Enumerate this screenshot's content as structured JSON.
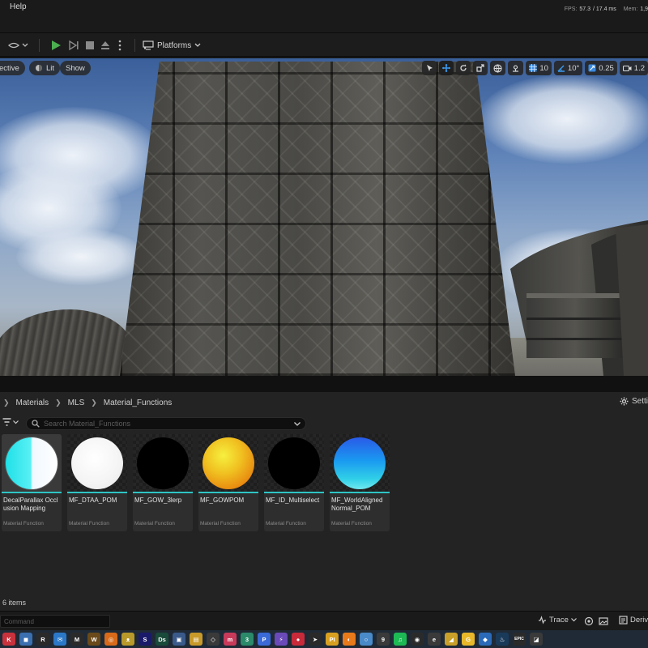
{
  "menu": {
    "help_label": "Help"
  },
  "stats": {
    "fps_label": "FPS:",
    "fps_value": "57.3",
    "ms_value": "/ 17.4 ms",
    "mem_label": "Mem:",
    "mem_value": "1,9"
  },
  "toolbar": {
    "platforms_label": "Platforms"
  },
  "viewport": {
    "perspective_label": "ective",
    "lit_label": "Lit",
    "show_label": "Show",
    "grid_snap": "10",
    "rotation_snap": "10°",
    "scale_snap": "0.25",
    "camera_speed": "1.2"
  },
  "content_browser": {
    "breadcrumb": [
      "Materials",
      "MLS",
      "Material_Functions"
    ],
    "settings_label": "Setti",
    "search_placeholder": "Search Material_Functions",
    "assets": [
      {
        "name": "DecalParallax Occlusion Mapping",
        "type": "Material Function",
        "color": "#28d8e0"
      },
      {
        "name": "MF_DTAA_POM",
        "type": "Material Function",
        "color": "#ffffff"
      },
      {
        "name": "MF_GOW_3lerp",
        "type": "Material Function",
        "color": "#000000"
      },
      {
        "name": "MF_GOWPOM",
        "type": "Material Function",
        "color": "#f0b020"
      },
      {
        "name": "MF_ID_Multiselect",
        "type": "Material Function",
        "color": "#000000"
      },
      {
        "name": "MF_WorldAligned Normal_POM",
        "type": "Material Function",
        "color": "#2a9af0"
      }
    ],
    "item_count": "6 items"
  },
  "command_bar": {
    "command_placeholder": "Command",
    "trace_label": "Trace",
    "derived_label": "Deriv"
  },
  "taskbar": {
    "apps": [
      {
        "name": "epic-games",
        "glyph": "K",
        "color": "#c8323c"
      },
      {
        "name": "app-blue",
        "glyph": "◼",
        "color": "#3a6fb0"
      },
      {
        "name": "app-r",
        "glyph": "R",
        "color": "#2a2a2a"
      },
      {
        "name": "mail",
        "glyph": "✉",
        "color": "#2b78c8"
      },
      {
        "name": "app-m",
        "glyph": "M",
        "color": "#2a2a2a"
      },
      {
        "name": "wow",
        "glyph": "W",
        "color": "#6a4a1a"
      },
      {
        "name": "app-orange",
        "glyph": "◎",
        "color": "#d86a1a"
      },
      {
        "name": "app-wings",
        "glyph": "ᴥ",
        "color": "#b89a2a"
      },
      {
        "name": "app-s",
        "glyph": "S",
        "color": "#1a1a6a"
      },
      {
        "name": "designer",
        "glyph": "Ds",
        "color": "#1a4a3a"
      },
      {
        "name": "app-monitor",
        "glyph": "▣",
        "color": "#3a5a8a"
      },
      {
        "name": "explorer",
        "glyph": "▤",
        "color": "#c89a2a"
      },
      {
        "name": "unity",
        "glyph": "◇",
        "color": "#3a3a3a"
      },
      {
        "name": "app-m2",
        "glyph": "m",
        "color": "#c83a5a"
      },
      {
        "name": "app-3",
        "glyph": "3",
        "color": "#2a8a6a"
      },
      {
        "name": "app-p",
        "glyph": "P",
        "color": "#3a6ad8"
      },
      {
        "name": "app-bolt",
        "glyph": "⚡",
        "color": "#6a4ab8"
      },
      {
        "name": "app-red",
        "glyph": "●",
        "color": "#c82a3a"
      },
      {
        "name": "app-arrow",
        "glyph": "➤",
        "color": "#2a2a2a"
      },
      {
        "name": "pycharm",
        "glyph": "PI",
        "color": "#d8a020"
      },
      {
        "name": "blender",
        "glyph": "◐",
        "color": "#e87a1a"
      },
      {
        "name": "app-ring",
        "glyph": "○",
        "color": "#4a8ac8"
      },
      {
        "name": "app-9",
        "glyph": "9",
        "color": "#3a3a3a"
      },
      {
        "name": "spotify",
        "glyph": "♫",
        "color": "#1db954"
      },
      {
        "name": "app-circle",
        "glyph": "◉",
        "color": "#2a2a2a"
      },
      {
        "name": "app-e",
        "glyph": "e",
        "color": "#3a3a3a"
      },
      {
        "name": "app-bird",
        "glyph": "◢",
        "color": "#c8a02a"
      },
      {
        "name": "app-g",
        "glyph": "G",
        "color": "#e8b82a"
      },
      {
        "name": "app-blue2",
        "glyph": "◆",
        "color": "#2a6ab8"
      },
      {
        "name": "steam",
        "glyph": "♨",
        "color": "#1a3a5a"
      },
      {
        "name": "epic-launcher",
        "glyph": "EPIC",
        "color": "#2a2a2a"
      },
      {
        "name": "app-last",
        "glyph": "◪",
        "color": "#3a3a3a"
      }
    ]
  },
  "colors": {
    "play_green": "#4caf50",
    "selection_teal": "#2fc4c4",
    "accent_blue": "#2a7ad8"
  }
}
